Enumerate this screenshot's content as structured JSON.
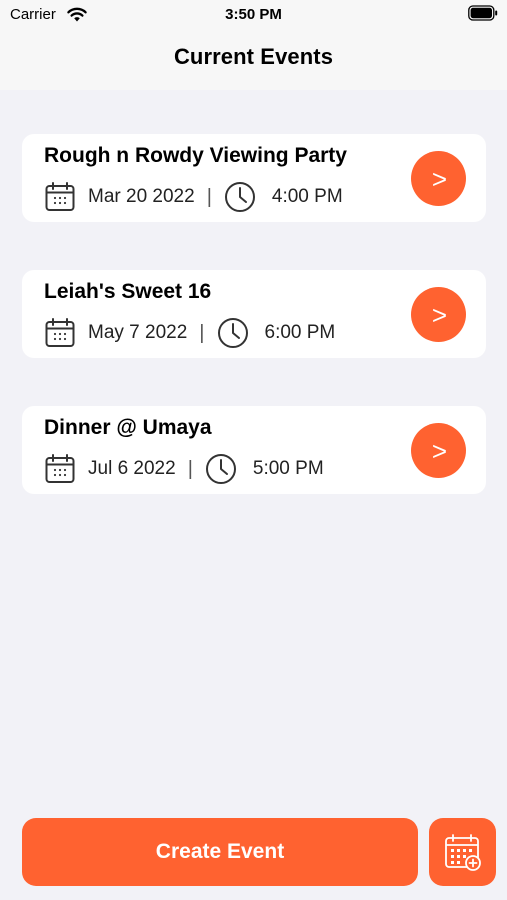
{
  "status_bar": {
    "carrier": "Carrier",
    "time": "3:50 PM",
    "wifi_icon": "wifi-icon",
    "battery_icon": "battery-icon"
  },
  "nav": {
    "title": "Current Events"
  },
  "events": [
    {
      "title": "Rough n Rowdy Viewing Party",
      "date": "Mar 20 2022",
      "separator": "|",
      "time": "4:00 PM"
    },
    {
      "title": "Leiah's Sweet 16",
      "date": "May 7 2022",
      "separator": "|",
      "time": "6:00 PM"
    },
    {
      "title": "Dinner @ Umaya",
      "date": "Jul 6 2022",
      "separator": "|",
      "time": "5:00 PM"
    }
  ],
  "event_button_glyph": ">",
  "footer": {
    "create_label": "Create Event",
    "calendar_button_icon": "calendar-add-icon"
  },
  "colors": {
    "accent": "#FF6230",
    "background": "#F2F2F7",
    "card": "#FFFFFF"
  }
}
